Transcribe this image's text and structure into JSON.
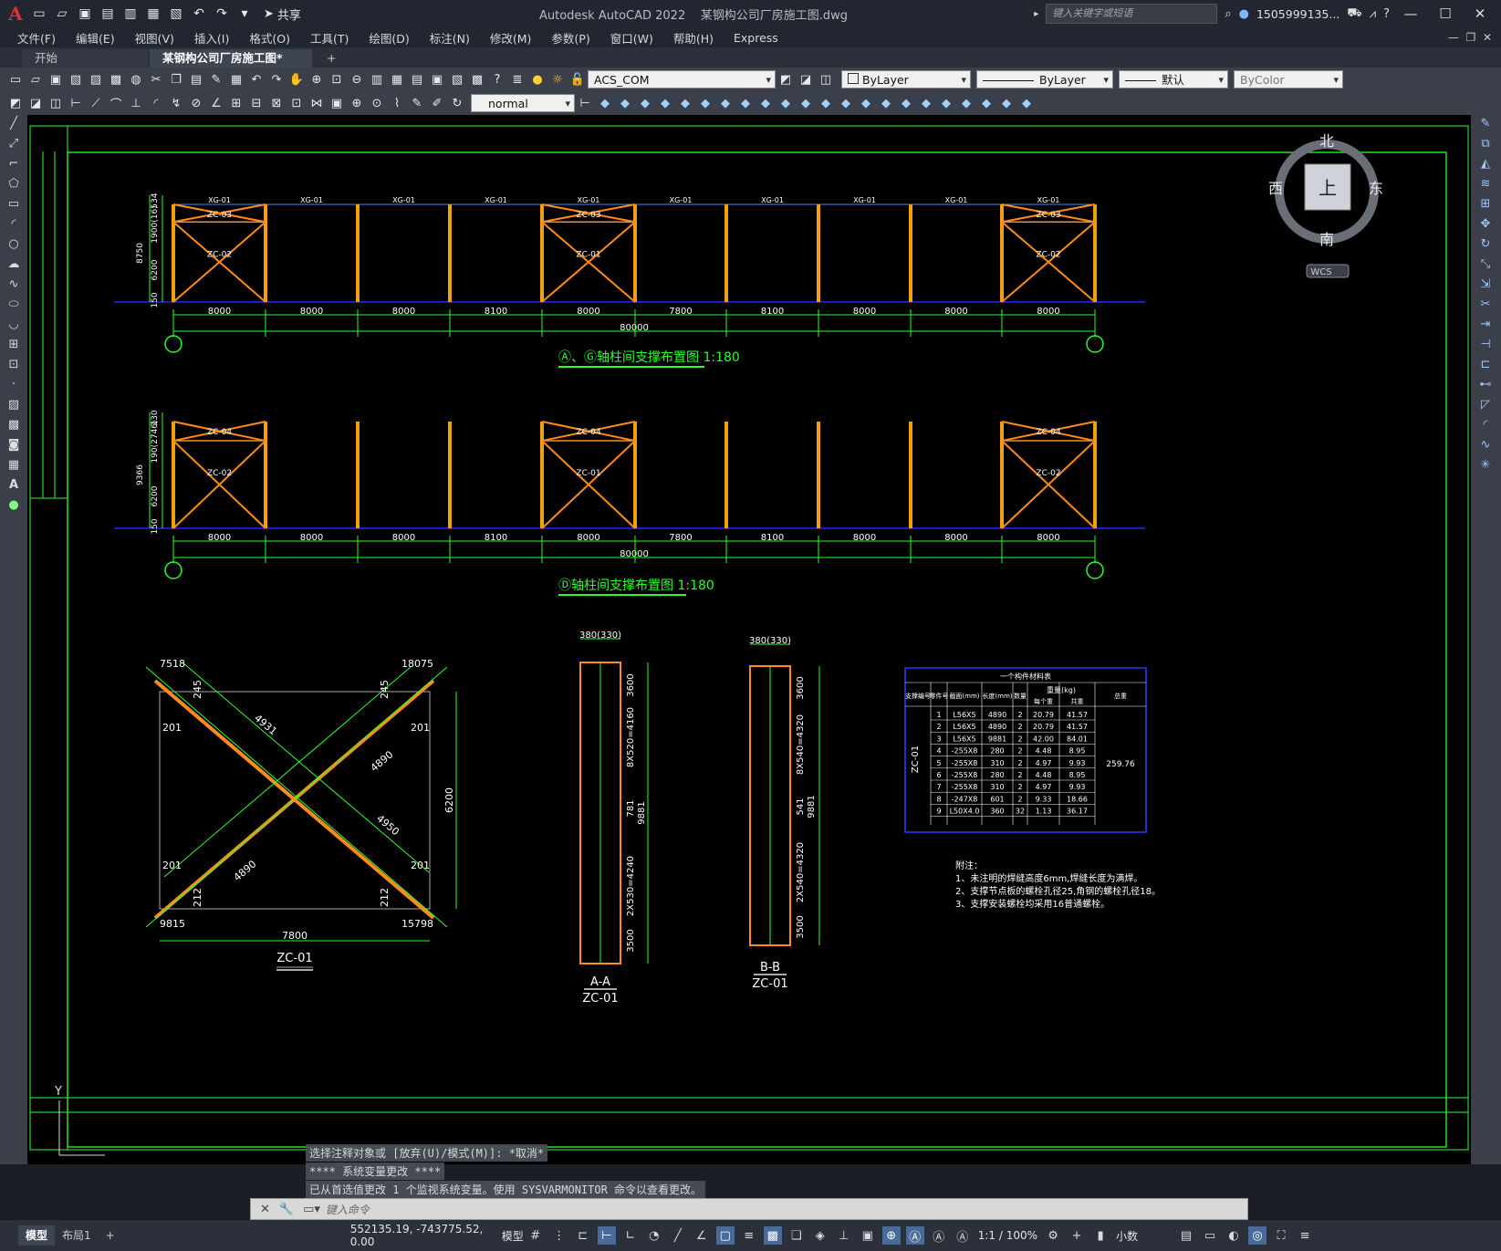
{
  "app": {
    "title": "Autodesk AutoCAD 2022",
    "document": "某钢构公司厂房施工图.dwg",
    "share_label": "共享",
    "search_placeholder": "键入关键字或短语",
    "user": "1505999135..."
  },
  "menu": [
    "文件(F)",
    "编辑(E)",
    "视图(V)",
    "插入(I)",
    "格式(O)",
    "工具(T)",
    "绘图(D)",
    "标注(N)",
    "修改(M)",
    "参数(P)",
    "窗口(W)",
    "帮助(H)",
    "Express"
  ],
  "tabs": [
    {
      "label": "开始"
    },
    {
      "label": "某钢构公司厂房施工图*"
    }
  ],
  "toolbar": {
    "layer": "ACS_COM",
    "color": "ByLayer",
    "linetype": "ByLayer",
    "lineweight": "默认",
    "plotstyle": "ByColor",
    "text_style": "normal"
  },
  "viewcube": {
    "north": "北",
    "south": "南",
    "east": "东",
    "west": "西",
    "face": "上",
    "wcs": "WCS"
  },
  "drawing": {
    "title1": "Ⓐ、Ⓖ轴柱间支撑布置图 1:180",
    "title2": "Ⓓ轴柱间支撑布置图 1:180",
    "spans": [
      "8000",
      "8000",
      "8000",
      "8100",
      "8000",
      "7800",
      "8100",
      "8000",
      "8000",
      "8000"
    ],
    "total": "80000",
    "xg_label": "XG-01",
    "elev1_left": [
      "8750",
      "6200",
      "1900(16)",
      "534",
      "150"
    ],
    "elev2_left": [
      "9366",
      "6200",
      "190(2746)",
      "130",
      "150"
    ],
    "zc_labels": [
      "ZC-03",
      "ZC-02",
      "ZC-01",
      "ZC-04"
    ],
    "detail_title": "ZC-01",
    "detail_dims": [
      "7800",
      "6200",
      "4931",
      "4890",
      "4950",
      "4890",
      "7518",
      "18075",
      "201",
      "245",
      "212",
      "9815",
      "15798"
    ],
    "section_aa": {
      "title": "A-A",
      "sub": "ZC-01",
      "top": "380(330)",
      "dims": [
        "3600",
        "8X520=4160",
        "781",
        "9881",
        "2X530=4240",
        "3500"
      ]
    },
    "section_bb": {
      "title": "B-B",
      "sub": "ZC-01",
      "top": "380(330)",
      "dims": [
        "3600",
        "8X540=4320",
        "541",
        "9881",
        "2X540=4320",
        "3500"
      ]
    },
    "table": {
      "title": "一个构件材料表",
      "headers": [
        "支撑编号",
        "零件号",
        "截面(mm)",
        "长度(mm)",
        "数量",
        "每个重",
        "共重",
        "总重"
      ],
      "weight_header": "重量(kg)",
      "member": "ZC-01",
      "total_weight": "259.76",
      "rows": [
        [
          "1",
          "L56X5",
          "4890",
          "2",
          "20.79",
          "41.57"
        ],
        [
          "2",
          "L56X5",
          "4890",
          "2",
          "20.79",
          "41.57"
        ],
        [
          "3",
          "L56X5",
          "9881",
          "2",
          "42.00",
          "84.01"
        ],
        [
          "4",
          "-255X8",
          "280",
          "2",
          "4.48",
          "8.95"
        ],
        [
          "5",
          "-255X8",
          "310",
          "2",
          "4.97",
          "9.93"
        ],
        [
          "6",
          "-255X8",
          "280",
          "2",
          "4.48",
          "8.95"
        ],
        [
          "7",
          "-255X8",
          "310",
          "2",
          "4.97",
          "9.93"
        ],
        [
          "8",
          "-247X8",
          "601",
          "2",
          "9.33",
          "18.66"
        ],
        [
          "9",
          "L50X4.0",
          "360",
          "32",
          "1.13",
          "36.17"
        ]
      ]
    },
    "notes": {
      "title": "附注：",
      "lines": [
        "1、未注明的焊缝高度6mm,焊缝长度为满焊。",
        "2、支撑节点板的螺栓孔径25,角钢的螺栓孔径18。",
        "3、支撑安装螺栓均采用16普通螺栓。"
      ]
    }
  },
  "command_history": [
    "选择注释对象或 [放弃(U)/模式(M)]: *取消*",
    "**** 系统变量更改 ****",
    "已从首选值更改 1 个监视系统变量。使用 SYSVARMONITOR 命令以查看更改。"
  ],
  "command_placeholder": "键入命令",
  "status": {
    "tab_model": "模型",
    "tab_layout": "布局1",
    "coords": "552135.19, -743775.52, 0.00",
    "space": "模型",
    "scale": "1:1 / 100%",
    "units": "小数"
  },
  "colors": {
    "canvas": "#000000",
    "frame": "#2aff2a",
    "column": "#f0a010",
    "brace": "#ff8c1a",
    "dim": "#2aff2a",
    "axis_line": "#1a2aff",
    "table_border": "#2a3aff"
  }
}
